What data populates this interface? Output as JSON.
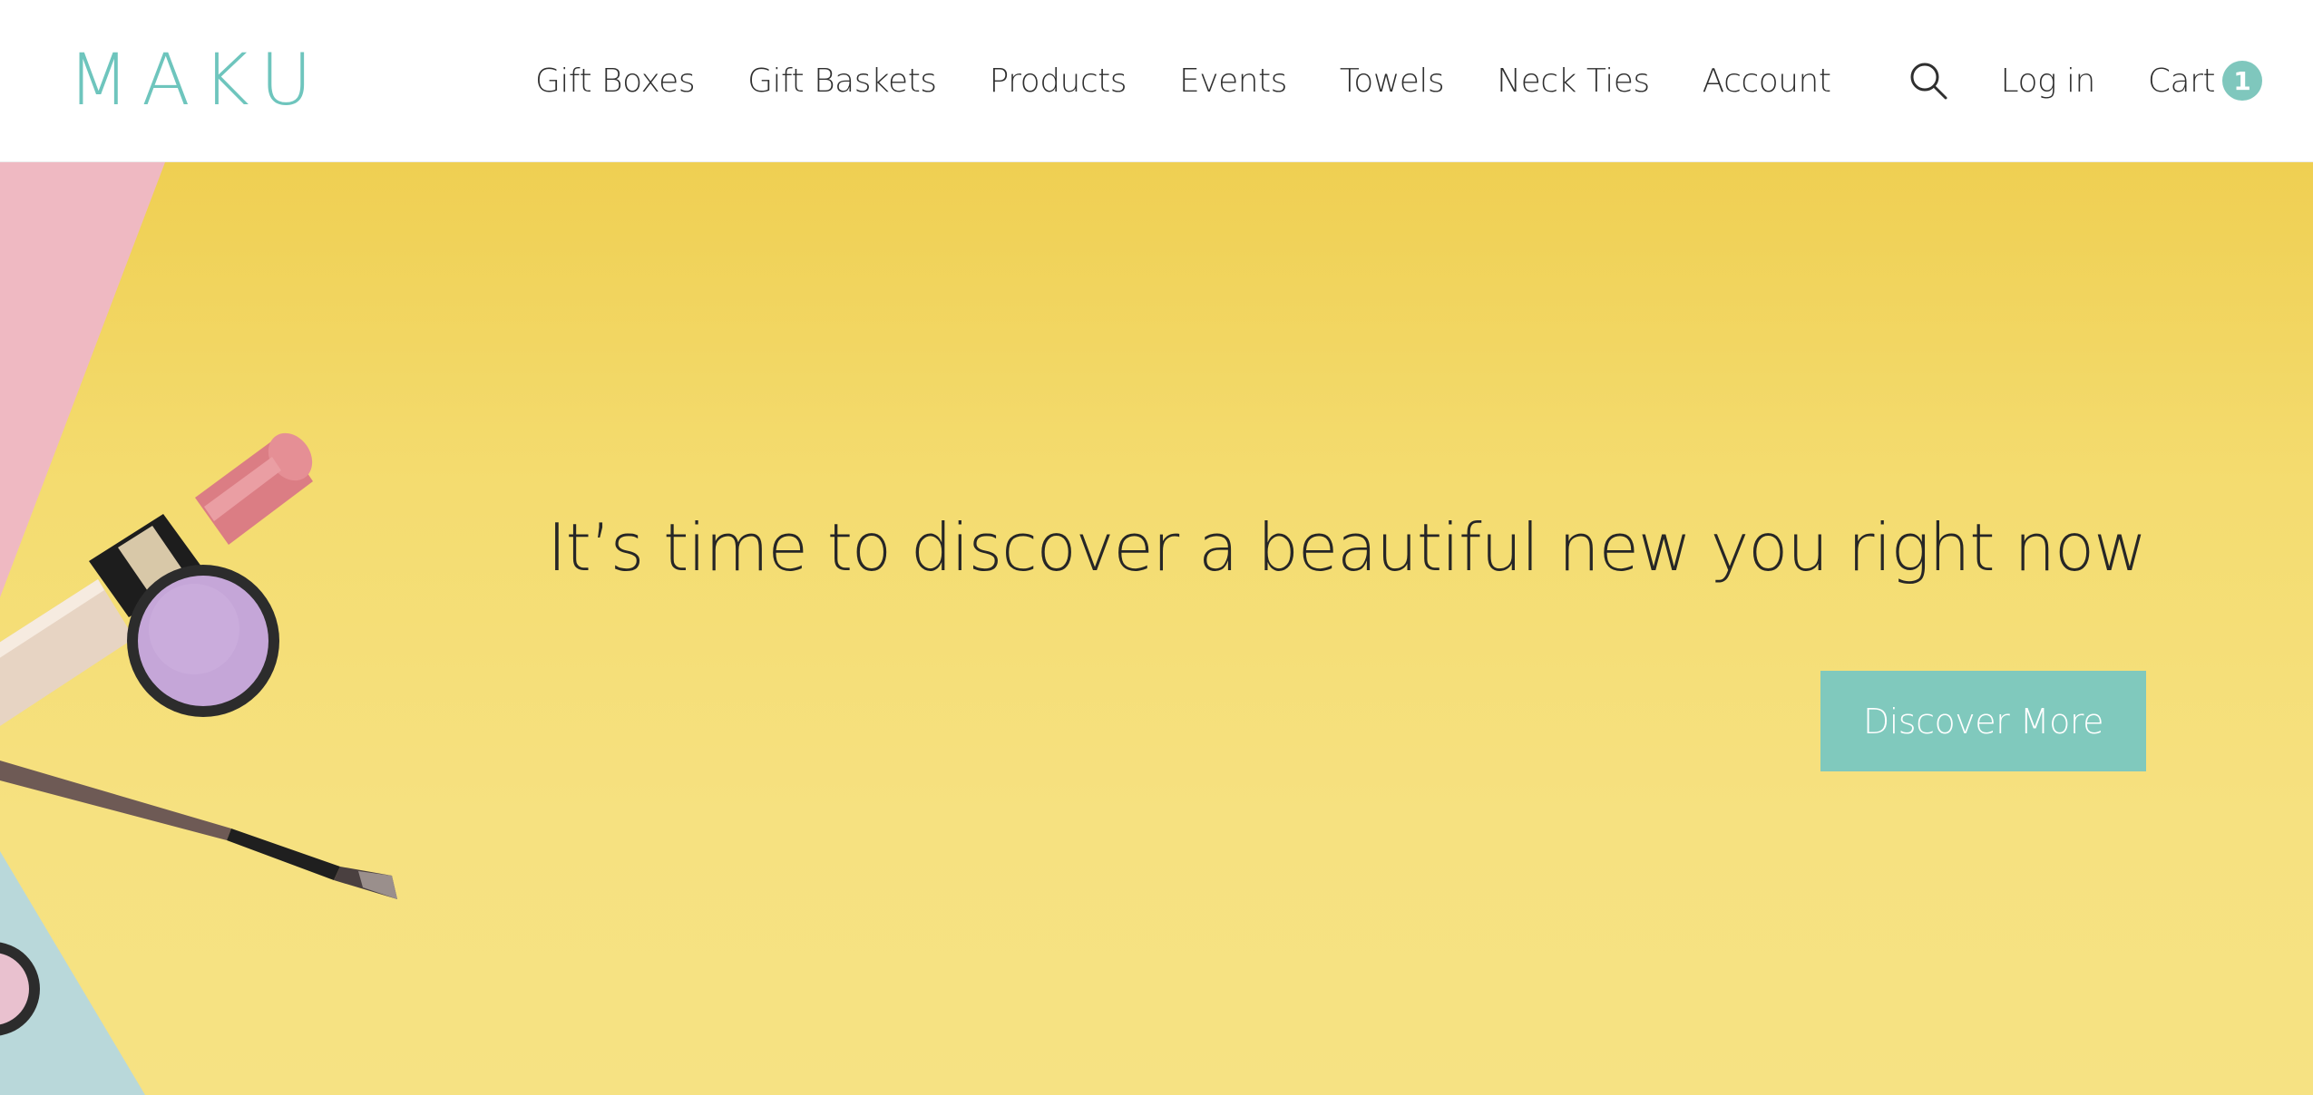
{
  "brand": {
    "logo_text": "MAKU",
    "accent_color": "#7fc7bd"
  },
  "nav": {
    "items": [
      {
        "label": "Gift Boxes"
      },
      {
        "label": "Gift Baskets"
      },
      {
        "label": "Products"
      },
      {
        "label": "Events"
      },
      {
        "label": "Towels"
      },
      {
        "label": "Neck Ties"
      },
      {
        "label": "Account"
      }
    ]
  },
  "utilities": {
    "search_icon": "search-icon",
    "login_label": "Log in",
    "cart_label": "Cart",
    "cart_count": "1"
  },
  "hero": {
    "headline": "It’s time to discover a beautiful new you right now",
    "button_label": "Discover More",
    "background_color": "#f6e180"
  }
}
